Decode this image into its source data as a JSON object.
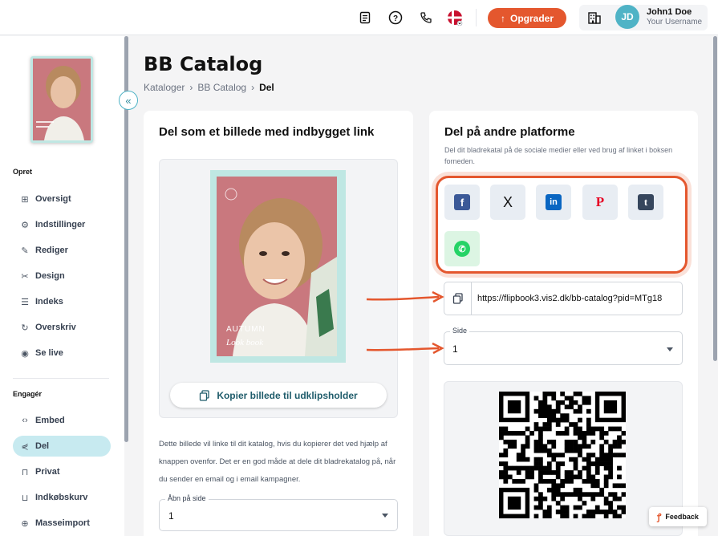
{
  "topbar": {
    "upgrade_label": "Opgrader",
    "user_name": "John1 Doe",
    "user_subtitle": "Your Username",
    "avatar_initials": "JD"
  },
  "sidebar": {
    "section_create": "Opret",
    "section_engage": "Engagér",
    "create_items": [
      {
        "label": "Oversigt",
        "icon": "layout-icon"
      },
      {
        "label": "Indstillinger",
        "icon": "gear-icon"
      },
      {
        "label": "Rediger",
        "icon": "pencil-icon"
      },
      {
        "label": "Design",
        "icon": "design-icon"
      },
      {
        "label": "Indeks",
        "icon": "list-icon"
      },
      {
        "label": "Overskriv",
        "icon": "refresh-icon"
      },
      {
        "label": "Se live",
        "icon": "eye-icon"
      }
    ],
    "engage_items": [
      {
        "label": "Embed",
        "icon": "code-icon"
      },
      {
        "label": "Del",
        "icon": "share-icon",
        "active": true
      },
      {
        "label": "Privat",
        "icon": "lock-icon"
      },
      {
        "label": "Indkøbskurv",
        "icon": "cart-icon"
      },
      {
        "label": "Masseimport",
        "icon": "import-icon"
      }
    ]
  },
  "page": {
    "title": "BB Catalog",
    "breadcrumb": [
      "Kataloger",
      "BB Catalog",
      "Del"
    ]
  },
  "image_card": {
    "title": "Del som et billede med indbygget link",
    "cover_text_1": "AUTUMN",
    "cover_text_2": "Look book",
    "copy_button": "Kopier billede til udklipsholder",
    "description": "Dette billede vil linke til dit katalog, hvis du kopierer det ved hjælp af knappen ovenfor. Det er en god måde at dele dit bladrekatalog på, når du sender en email og i email kampagner.",
    "page_select_label": "Åbn på side",
    "page_select_value": "1"
  },
  "share_card": {
    "title": "Del på andre platforme",
    "subtitle": "Del dit bladrekatal på de sociale medier eller ved brug af linket i boksen forneden.",
    "social": [
      {
        "name": "facebook",
        "glyph": "f",
        "color": "#3b5998"
      },
      {
        "name": "x",
        "glyph": "X",
        "color": "#111111"
      },
      {
        "name": "linkedin",
        "glyph": "in",
        "color": "#0a66c2"
      },
      {
        "name": "pinterest",
        "glyph": "P",
        "color": "#e60023"
      },
      {
        "name": "tumblr",
        "glyph": "t",
        "color": "#36465d"
      },
      {
        "name": "whatsapp",
        "glyph": "✆",
        "color": "#25d366"
      }
    ],
    "link_url": "https://flipbook3.vis2.dk/bb-catalog?pid=MTg18",
    "side_label": "Side",
    "side_value": "1"
  },
  "feedback_label": "Feedback",
  "colors": {
    "accent": "#e4572e",
    "teal": "#4fb3c6",
    "active_nav": "#c7eaf0"
  }
}
